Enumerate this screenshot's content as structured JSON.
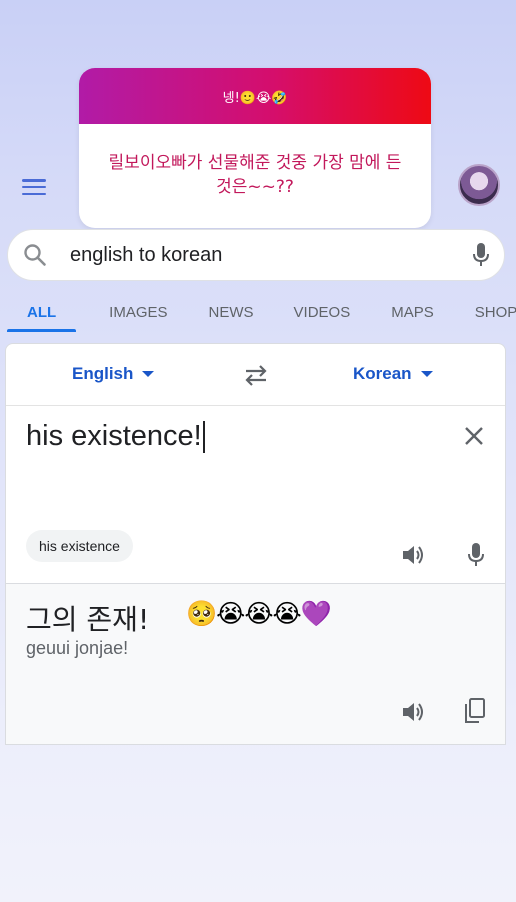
{
  "sticker": {
    "header": "넹!🙂😭🤣",
    "question": "릴보이오빠가 선물해준 것중 가장 맘에 든것은~~??"
  },
  "search": {
    "query": "english to korean"
  },
  "tabs": [
    "ALL",
    "IMAGES",
    "NEWS",
    "VIDEOS",
    "MAPS",
    "SHOPPIN"
  ],
  "translate": {
    "source_lang": "English",
    "target_lang": "Korean",
    "input_text": "his existence!",
    "suggestion_chip": "his existence",
    "output_text": "그의 존재!",
    "output_emoji": "🥺😭😭😭💜",
    "romanization": "geuui jonjae!"
  },
  "colors": {
    "accent": "#1a73e8",
    "lang_blue": "#1a56c8",
    "sticker_gradient_start": "#b11ba7",
    "sticker_gradient_end": "#ee0a14",
    "sticker_text": "#c2185b"
  }
}
